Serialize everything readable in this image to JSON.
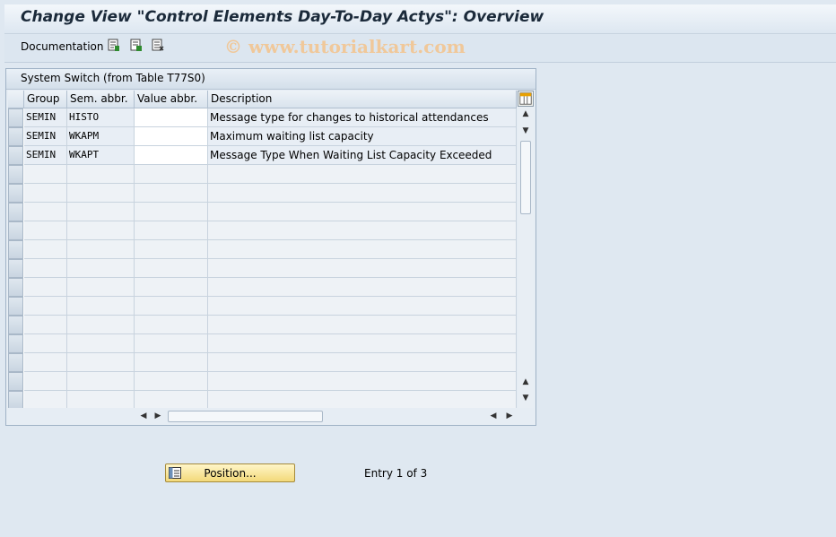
{
  "title": "Change View \"Control Elements Day-To-Day Actys\": Overview",
  "toolbar": {
    "documentation_label": "Documentation",
    "icons": [
      "details-icon",
      "copy-icon",
      "delimit-icon"
    ],
    "watermark": "© www.tutorialkart.com"
  },
  "table": {
    "frame_title": "System Switch (from Table T77S0)",
    "columns": [
      "Group",
      "Sem. abbr.",
      "Value abbr.",
      "Description"
    ],
    "rows": [
      {
        "group": "SEMIN",
        "sem_abbr": "HISTO",
        "value_abbr": "",
        "description": "Message type for changes to historical attendances"
      },
      {
        "group": "SEMIN",
        "sem_abbr": "WKAPM",
        "value_abbr": "",
        "description": "Maximum waiting list capacity"
      },
      {
        "group": "SEMIN",
        "sem_abbr": "WKAPT",
        "value_abbr": "",
        "description": "Message Type When Waiting List Capacity Exceeded"
      }
    ],
    "empty_row_count": 13
  },
  "footer": {
    "position_button_label": "Position...",
    "entry_text": "Entry 1 of 3"
  },
  "colors": {
    "background": "#dfe8f1",
    "position_button": "#f3d97a",
    "watermark": "#f0c89a"
  }
}
